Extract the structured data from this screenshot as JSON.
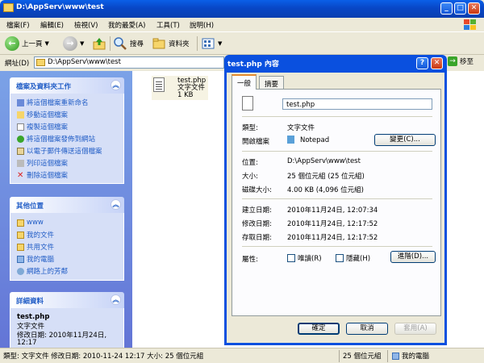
{
  "window": {
    "title": "D:\\AppServ\\www\\test"
  },
  "menu": [
    "檔案(F)",
    "編輯(E)",
    "檢視(V)",
    "我的最愛(A)",
    "工具(T)",
    "說明(H)"
  ],
  "toolbar": {
    "back": "上一頁",
    "search": "搜尋",
    "folders": "資料夾"
  },
  "address": {
    "label": "網址(D)",
    "value": "D:\\AppServ\\www\\test",
    "go": "移至"
  },
  "tasks": {
    "title": "檔案及資料夾工作",
    "items": [
      "將這個檔案重新命名",
      "移動這個檔案",
      "複製這個檔案",
      "將這個檔案發佈到網站",
      "以電子郵件傳送這個檔案",
      "列印這個檔案",
      "刪除這個檔案"
    ]
  },
  "places": {
    "title": "其他位置",
    "items": [
      "www",
      "我的文件",
      "共用文件",
      "我的電腦",
      "網路上的芳鄰"
    ]
  },
  "details": {
    "title": "詳細資料",
    "name": "test.php",
    "type": "文字文件",
    "modified": "修改日期: 2010年11月24日,",
    "time": "12:17"
  },
  "file": {
    "name": "test.php",
    "type": "文字文件",
    "size": "1 KB"
  },
  "status": {
    "text": "類型: 文字文件 修改日期: 2010-11-24 12:17 大小: 25 個位元組",
    "size": "25 個位元組",
    "zone": "我的電腦"
  },
  "dialog": {
    "title": "test.php 內容",
    "tabs": [
      "一般",
      "摘要"
    ],
    "filename": "test.php",
    "type_label": "類型:",
    "type_value": "文字文件",
    "opens_label": "開啟檔案",
    "opens_value": "Notepad",
    "change": "變更(C)...",
    "location_label": "位置:",
    "location_value": "D:\\AppServ\\www\\test",
    "size_label": "大小:",
    "size_value": "25 個位元組 (25 位元組)",
    "disk_label": "磁碟大小:",
    "disk_value": "4.00 KB (4,096 位元組)",
    "created_label": "建立日期:",
    "created_value": "2010年11月24日, 12:07:34",
    "modified_label": "修改日期:",
    "modified_value": "2010年11月24日, 12:17:52",
    "accessed_label": "存取日期:",
    "accessed_value": "2010年11月24日, 12:17:52",
    "attr_label": "屬性:",
    "readonly": "唯讀(R)",
    "hidden": "隱藏(H)",
    "advanced": "進階(D)...",
    "ok": "確定",
    "cancel": "取消",
    "apply": "套用(A)"
  }
}
